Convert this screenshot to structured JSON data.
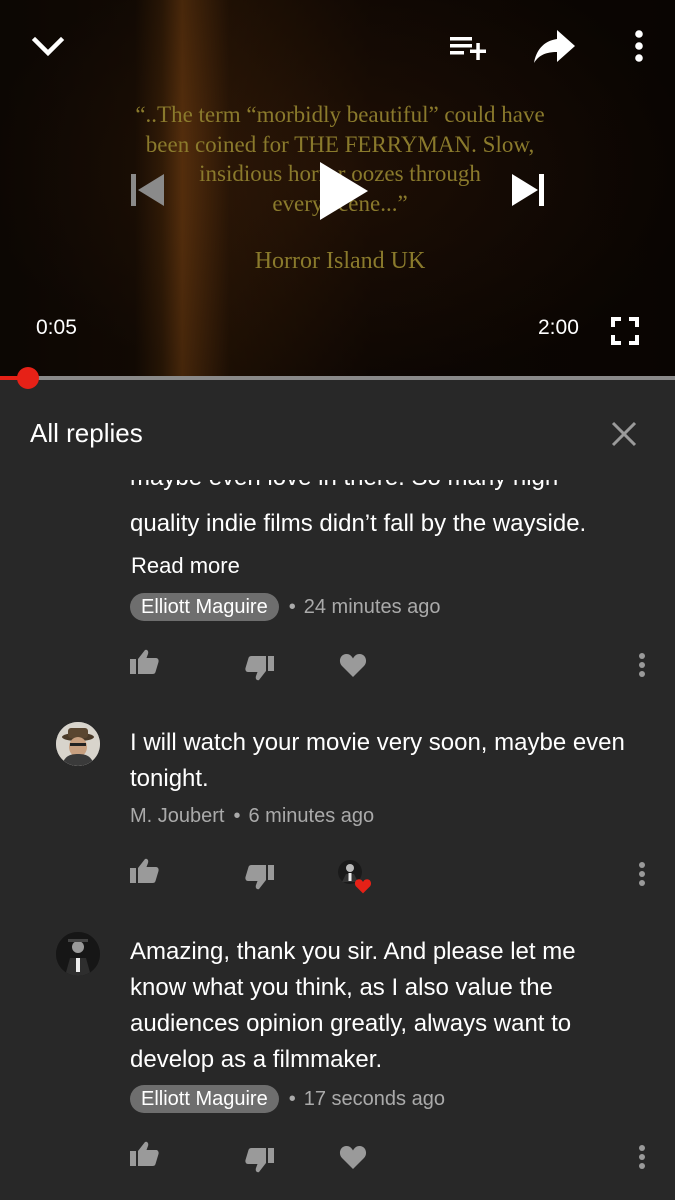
{
  "player": {
    "quote_lines": [
      "“..The term “morbidly beautiful” could have",
      "been coined for THE FERRYMAN. Slow,",
      "insidious horror oozes through",
      "every scene...”"
    ],
    "quote_source": "Horror Island UK",
    "elapsed": "0:05",
    "duration": "2:00",
    "progress_fraction": 0.042,
    "icons": [
      "chevron-down-icon",
      "add-to-playlist-icon",
      "share-icon",
      "more-vert-icon",
      "skip-previous-icon",
      "play-icon",
      "skip-next-icon",
      "fullscreen-icon"
    ]
  },
  "panel": {
    "title": "All replies"
  },
  "replies": [
    {
      "clipped_line": "maybe even love in there. So many high-",
      "text_lines": [
        "quality indie films didn’t fall by the wayside."
      ],
      "read_more": "Read more",
      "author": "Elliott Maguire",
      "author_chip": true,
      "time": "24 minutes ago"
    },
    {
      "text_lines": [
        "I will watch your movie very soon, maybe even",
        "tonight."
      ],
      "author": "M. Joubert",
      "author_chip": false,
      "time": "6 minutes ago",
      "creator_hearted": true
    },
    {
      "text_lines": [
        "Amazing, thank you sir. And please let me",
        "know what you think, as I also value the",
        "audiences opinion greatly, always want to",
        "develop as a filmmaker."
      ],
      "author": "Elliott Maguire",
      "author_chip": true,
      "time": "17 seconds ago"
    }
  ],
  "colors": {
    "accent": "#e62117",
    "background": "#282828",
    "chip": "#6e6e6e",
    "meta_text": "#aaaaaa",
    "icon": "#9a9a9a"
  }
}
